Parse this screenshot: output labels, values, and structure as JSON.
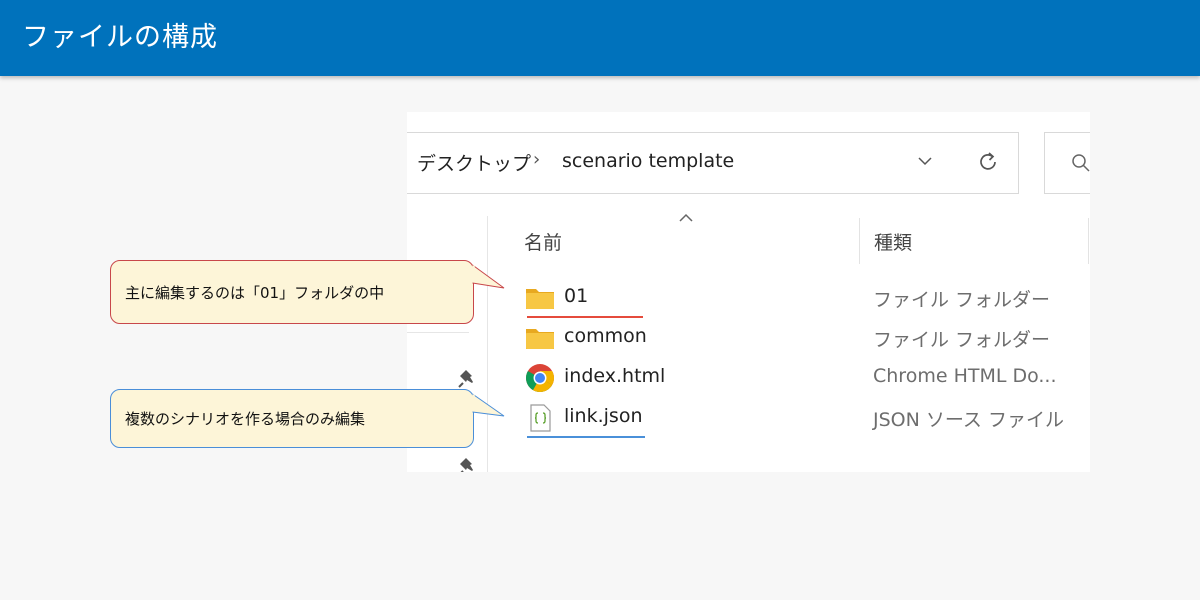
{
  "header": {
    "title": "ファイルの構成"
  },
  "explorer": {
    "breadcrumb": {
      "root": "デスクトップ",
      "separator": "›",
      "folder": "scenario template"
    },
    "columns": {
      "name": "名前",
      "type": "種類"
    },
    "files": [
      {
        "name": "01",
        "type": "ファイル フォルダー",
        "icon": "folder-icon"
      },
      {
        "name": "common",
        "type": "ファイル フォルダー",
        "icon": "folder-icon"
      },
      {
        "name": "index.html",
        "type": "Chrome HTML Do...",
        "icon": "chrome-icon"
      },
      {
        "name": "link.json",
        "type": "JSON ソース ファイル",
        "icon": "json-file-icon"
      }
    ]
  },
  "callouts": {
    "main_edit": "主に編集するのは「01」フォルダの中",
    "multi_scenario": "複数のシナリオを作る場合のみ編集"
  },
  "colors": {
    "header": "#0072bc",
    "callout_fill": "#fdf5d8",
    "callout_red": "#c8474a",
    "callout_blue": "#4a8ed8",
    "folder": "#f7c744"
  }
}
